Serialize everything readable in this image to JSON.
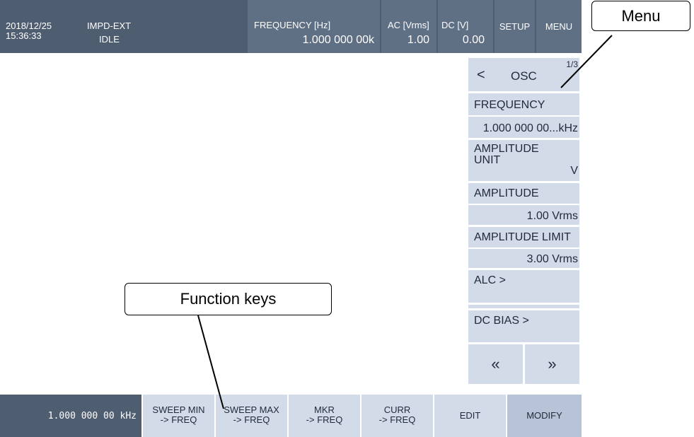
{
  "status_bar": {
    "date": "2018/12/25",
    "time": "15:36:33",
    "mode": "IMPD-EXT",
    "state": "IDLE",
    "frequency_label": "FREQUENCY [Hz]",
    "frequency_value": "1.000 000 00k",
    "ac_label": "AC [Vrms]",
    "ac_value": "1.00",
    "dc_label": "DC [V]",
    "dc_value": "0.00",
    "setup_label": "SETUP",
    "menu_label": "MENU"
  },
  "menu": {
    "title": "OSC",
    "page": "1/3",
    "back_glyph": "<",
    "items": [
      {
        "label": "FREQUENCY",
        "value": "1.000 000 00...kHz"
      },
      {
        "label": "AMPLITUDE UNIT",
        "label_line1": "AMPLITUDE",
        "label_line2": "UNIT",
        "value": "V"
      },
      {
        "label": "AMPLITUDE",
        "value": "1.00 Vrms"
      },
      {
        "label": "AMPLITUDE LIMIT",
        "value": "3.00 Vrms"
      },
      {
        "label": "ALC >"
      },
      {
        "label": "DC BIAS >"
      }
    ],
    "prev_page_glyph": "«",
    "next_page_glyph": "»"
  },
  "function_keys": {
    "value_display": "1.000 000 00 kHz",
    "keys": [
      {
        "line1": "SWEEP MIN",
        "line2": "-> FREQ"
      },
      {
        "line1": "SWEEP MAX",
        "line2": "-> FREQ"
      },
      {
        "line1": "MKR",
        "line2": "-> FREQ"
      },
      {
        "line1": "CURR",
        "line2": "-> FREQ"
      },
      {
        "line1": "EDIT"
      },
      {
        "line1": "MODIFY"
      }
    ]
  },
  "callouts": {
    "menu": "Menu",
    "function_keys": "Function keys"
  },
  "colors": {
    "status_bar": "#4f5d70",
    "status_cell": "#5f6f84",
    "menu_item": "#d3dbe8",
    "value_display": "#4f5d70",
    "modify_key": "#b7c3d6"
  }
}
